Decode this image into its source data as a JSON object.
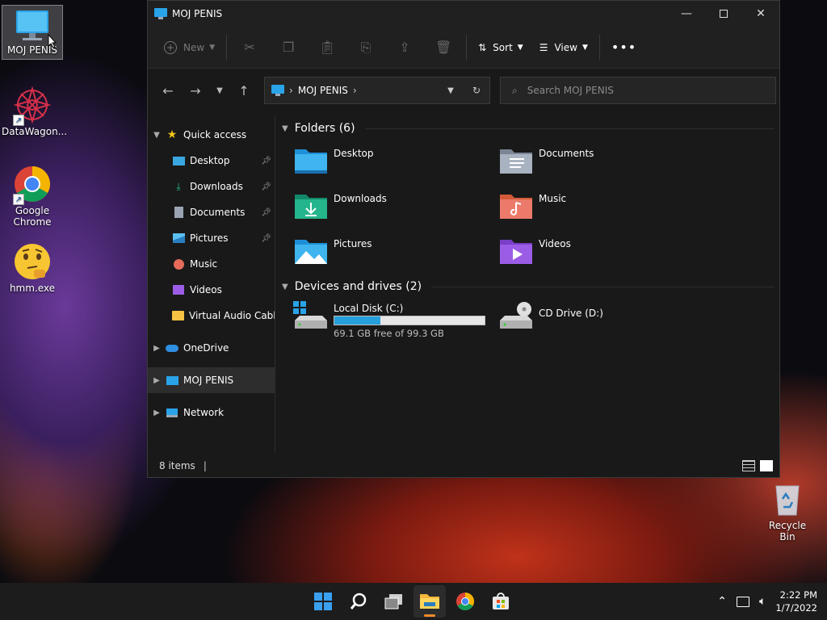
{
  "desktop": {
    "icons": [
      {
        "label": "MOJ PENIS",
        "icon": "computer-icon"
      },
      {
        "label": "DataWagon...",
        "icon": "datawagon-icon"
      },
      {
        "label": "Google Chrome",
        "icon": "chrome-icon"
      },
      {
        "label": "hmm.exe",
        "icon": "thinking-face-icon"
      }
    ],
    "recycle_bin": "Recycle Bin"
  },
  "window": {
    "title": "MOJ PENIS",
    "controls": [
      "minimize",
      "maximize",
      "close"
    ]
  },
  "toolbar": {
    "new_label": "New",
    "sort_label": "Sort",
    "view_label": "View",
    "icons": [
      "cut-icon",
      "copy-icon",
      "paste-icon",
      "rename-icon",
      "share-icon",
      "delete-icon"
    ]
  },
  "address": {
    "location": "MOJ PENIS",
    "search_placeholder": "Search MOJ PENIS"
  },
  "sidebar": {
    "quick_access": "Quick access",
    "items": [
      {
        "label": "Desktop",
        "pinned": true
      },
      {
        "label": "Downloads",
        "pinned": true
      },
      {
        "label": "Documents",
        "pinned": true
      },
      {
        "label": "Pictures",
        "pinned": true
      },
      {
        "label": "Music",
        "pinned": false
      },
      {
        "label": "Videos",
        "pinned": false
      },
      {
        "label": "Virtual Audio Cabl",
        "pinned": false
      }
    ],
    "onedrive": "OneDrive",
    "this_pc": "MOJ PENIS",
    "network": "Network"
  },
  "content": {
    "folders_header": "Folders (6)",
    "folders": [
      "Desktop",
      "Documents",
      "Downloads",
      "Music",
      "Pictures",
      "Videos"
    ],
    "drives_header": "Devices and drives (2)",
    "drives": [
      {
        "name": "Local Disk (C:)",
        "free_text": "69.1 GB free of 99.3 GB",
        "used_fraction": 0.304
      },
      {
        "name": "CD Drive (D:)"
      }
    ]
  },
  "status": {
    "items": "8 items"
  },
  "taskbar": {
    "time": "2:22 PM",
    "date": "1/7/2022"
  },
  "colors": {
    "accent": "#0078d4",
    "file_explorer_indicator": "#f28c28"
  }
}
